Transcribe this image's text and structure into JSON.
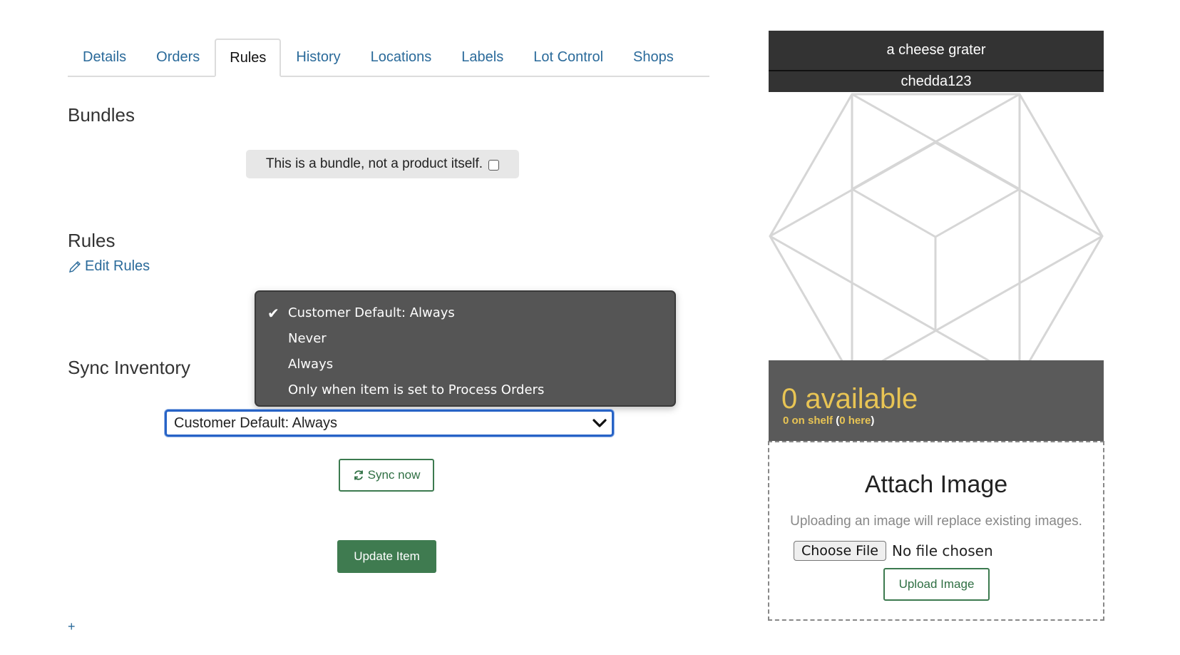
{
  "tabs": [
    {
      "label": "Details"
    },
    {
      "label": "Orders"
    },
    {
      "label": "Rules",
      "active": true
    },
    {
      "label": "History"
    },
    {
      "label": "Locations"
    },
    {
      "label": "Labels"
    },
    {
      "label": "Lot Control"
    },
    {
      "label": "Shops"
    }
  ],
  "bundles": {
    "title": "Bundles",
    "checkbox_label": "This is a bundle, not a product itself.",
    "checked": false
  },
  "rules": {
    "title": "Rules",
    "edit_label": "Edit Rules"
  },
  "sync": {
    "title": "Sync Inventory",
    "selected": "Customer Default: Always",
    "options": [
      "Customer Default: Always",
      "Never",
      "Always",
      "Only when item is set to Process Orders"
    ],
    "sync_now_label": "Sync now"
  },
  "update_label": "Update Item",
  "plus_label": "+",
  "panel": {
    "name": "a cheese grater",
    "sku": "chedda123",
    "available": "0 available",
    "on_shelf": "0 on shelf",
    "here": "0 here",
    "open_paren": "(",
    "close_paren": ")"
  },
  "attach": {
    "title": "Attach Image",
    "note": "Uploading an image will replace existing images.",
    "choose_label": "Choose File",
    "no_file": "No file chosen",
    "upload_label": "Upload Image"
  },
  "colors": {
    "accent_green": "#3f7b50",
    "link_blue": "#2a6a9a",
    "availability_yellow": "#e8c454"
  }
}
